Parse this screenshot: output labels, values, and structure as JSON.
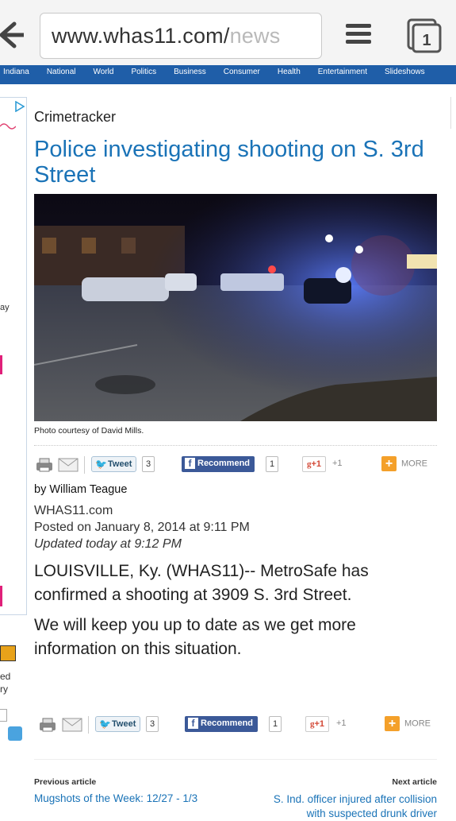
{
  "browser": {
    "url_main": "www.whas11.com/",
    "url_fade": "news",
    "tab_count": "1"
  },
  "nav": {
    "items": [
      "Indiana",
      "National",
      "World",
      "Politics",
      "Business",
      "Consumer",
      "Health",
      "Entertainment",
      "Slideshows"
    ]
  },
  "ad_fragments": [
    "ay",
    "ed",
    "ry"
  ],
  "article": {
    "section": "Crimetracker",
    "headline": "Police investigating shooting on S. 3rd Street",
    "caption": "Photo courtesy of David Mills.",
    "byline": "by William Teague",
    "source": "WHAS11.com",
    "posted": "Posted on January 8, 2014 at 9:11 PM",
    "updated": "Updated today at 9:12 PM",
    "paragraphs": [
      "LOUISVILLE, Ky. (WHAS11)-- MetroSafe has confirmed a shooting at 3909 S. 3rd Street.",
      "We will keep you up to date as we get more information on this situation."
    ]
  },
  "share": {
    "tweet_label": "Tweet",
    "tweet_count": "3",
    "recommend_label": "Recommend",
    "recommend_count": "1",
    "gplus_label": "+1",
    "gplus_count": "+1",
    "more_label": "MORE"
  },
  "pager": {
    "prev_label": "Previous article",
    "prev_title": "Mugshots of the Week: 12/27 - 1/3",
    "next_label": "Next article",
    "next_title": "S. Ind. officer injured after collision with suspected drunk driver"
  },
  "colors": {
    "link": "#1a73b7",
    "nav": "#1f5ea8",
    "facebook": "#3b5998",
    "more": "#f4a02a"
  }
}
